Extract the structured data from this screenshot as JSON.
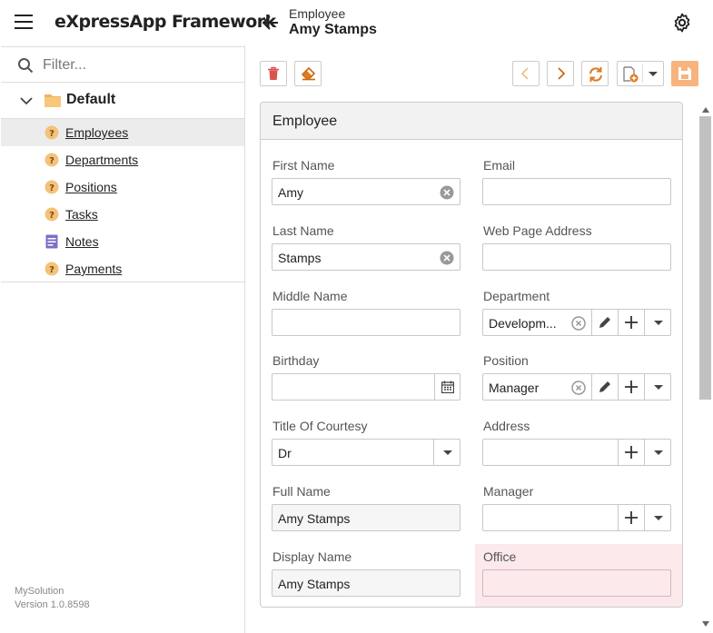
{
  "header": {
    "app_title": "eXpressApp Framework",
    "view_caption": "Employee",
    "object_caption": "Amy Stamps"
  },
  "sidebar": {
    "filter_placeholder": "Filter...",
    "group": "Default",
    "items": [
      {
        "label": "Employees",
        "icon": "bo-icon",
        "selected": true
      },
      {
        "label": "Departments",
        "icon": "bo-icon"
      },
      {
        "label": "Positions",
        "icon": "bo-icon"
      },
      {
        "label": "Tasks",
        "icon": "bo-icon"
      },
      {
        "label": "Notes",
        "icon": "note-icon"
      },
      {
        "label": "Payments",
        "icon": "bo-icon"
      }
    ],
    "solution": "MySolution",
    "version": "Version 1.0.8598"
  },
  "colors": {
    "accent": "#e07b1f",
    "delete": "#d9534f",
    "save": "#f7b47f",
    "error_bg": "#fbe9ec"
  },
  "panel": {
    "title": "Employee",
    "fields": {
      "first_name": {
        "label": "First Name",
        "value": "Amy"
      },
      "email": {
        "label": "Email",
        "value": ""
      },
      "last_name": {
        "label": "Last Name",
        "value": "Stamps"
      },
      "web_page": {
        "label": "Web Page Address",
        "value": ""
      },
      "middle_name": {
        "label": "Middle Name",
        "value": ""
      },
      "department": {
        "label": "Department",
        "value": "Developm..."
      },
      "birthday": {
        "label": "Birthday",
        "value": ""
      },
      "position": {
        "label": "Position",
        "value": "Manager"
      },
      "title_of_courtesy": {
        "label": "Title Of Courtesy",
        "value": "Dr"
      },
      "address": {
        "label": "Address",
        "value": ""
      },
      "full_name": {
        "label": "Full Name",
        "value": "Amy Stamps"
      },
      "manager": {
        "label": "Manager",
        "value": ""
      },
      "display_name": {
        "label": "Display Name",
        "value": "Amy Stamps"
      },
      "office": {
        "label": "Office",
        "value": ""
      }
    }
  }
}
